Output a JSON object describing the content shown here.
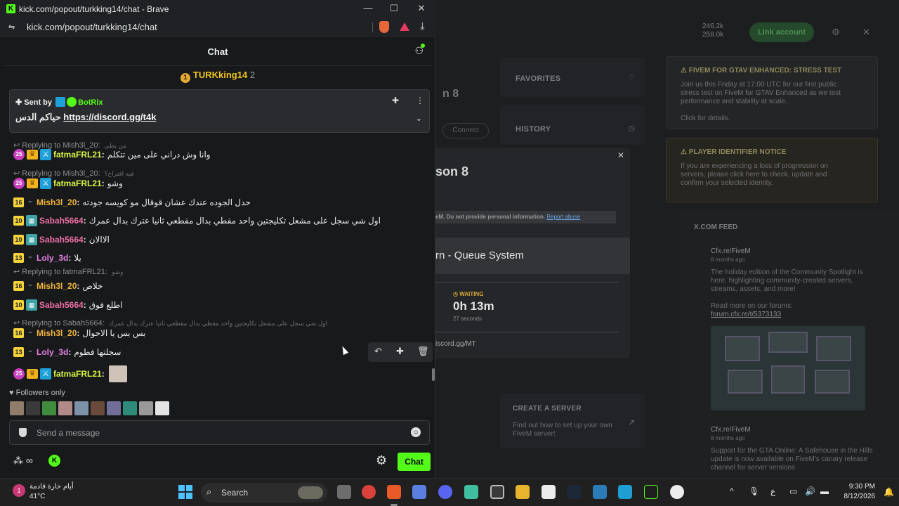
{
  "window": {
    "title": "kick.com/popout/turkking14/chat - Brave",
    "url": "kick.com/popout/turkking14/chat"
  },
  "chat": {
    "header_title": "Chat",
    "gift": {
      "user": "TURKking14",
      "count": "2"
    },
    "pinned": {
      "sent_by_label": "Sent by",
      "bot_name": "BotRix",
      "text": "حياكم الدس",
      "link": "https://discord.gg/t4k"
    },
    "messages": [
      {
        "reply_to": "Replying to Mish3l_20:",
        "reply_quote": "من بطي",
        "badges": [
          "circ:25",
          "crown",
          "sword"
        ],
        "user": "fatmaFRL21",
        "user_color": "#d7f742",
        "text": "وانا وش دراني على مين تتكلم"
      },
      {
        "reply_to": "Replying to Mish3l_20:",
        "reply_quote": "فيه اقتراح؟",
        "badges": [
          "circ:25",
          "crown",
          "sword"
        ],
        "user": "fatmaFRL21",
        "user_color": "#d7f742",
        "text": "وشو"
      },
      {
        "badges": [
          "num:16",
          "dash"
        ],
        "user": "Mish3l_20",
        "user_color": "#f0b43c",
        "text": "حدل الجوده عندك عشان قوقال مو كويسه جودته"
      },
      {
        "badges": [
          "num:10",
          "grid"
        ],
        "user": "Sabah5664",
        "user_color": "#ee6fa6",
        "text": "اول شي سجل على مشعل تكليجتين واحد مقطي بدال مقطعي ثانيا عترك بدال عمرك"
      },
      {
        "badges": [
          "num:10",
          "grid"
        ],
        "user": "Sabah5664",
        "user_color": "#ee6fa6",
        "text": "الاالان"
      },
      {
        "badges": [
          "num:13",
          "dash"
        ],
        "user": "Loly_3d",
        "user_color": "#e580e6",
        "text": "يلا"
      },
      {
        "reply_to": "Replying to fatmaFRL21:",
        "reply_quote": "وشو",
        "badges": [
          "num:16",
          "dash"
        ],
        "user": "Mish3l_20",
        "user_color": "#f0b43c",
        "text": "خلاص"
      },
      {
        "badges": [
          "num:10",
          "grid"
        ],
        "user": "Sabah5664",
        "user_color": "#ee6fa6",
        "text": "اطلع فوق"
      },
      {
        "reply_to": "Replying to Sabah5664:",
        "reply_quote": "اول شي سجل على مشعل تكليجتين واحد مقطي بدال مقطعي ثانيا عترك بدال عمرك",
        "badges": [
          "num:16",
          "dash"
        ],
        "user": "Mish3l_20",
        "user_color": "#f0b43c",
        "text": "بس بس يا الاحوال"
      },
      {
        "badges": [
          "num:13",
          "dash"
        ],
        "user": "Loly_3d",
        "user_color": "#e580e6",
        "text": "سجلتها فطوم"
      },
      {
        "badges": [
          "circ:25",
          "crown",
          "sword"
        ],
        "user": "fatmaFRL21",
        "user_color": "#d7f742",
        "text": ""
      }
    ],
    "followers_only": "Followers only",
    "input_placeholder": "Send a message",
    "send_button": "Chat"
  },
  "background_app": {
    "stats": [
      "246.2k",
      "258.0k"
    ],
    "link_account": "Link account",
    "favorites": "FAVORITES",
    "history": "HISTORY",
    "connect": "Connect",
    "season_digit": "n 8",
    "notice1_title": "FIVEM FOR GTAV ENHANCED: STRESS TEST",
    "notice1_body": "Join us this Friday at 17:00 UTC for our first public stress test on FiveM for GTAV Enhanced as we test performance and stability at scale.",
    "notice1_link": "Click for details.",
    "notice2_title": "PLAYER IDENTIFIER NOTICE",
    "notice2_body": "If you are experiencing a loss of progression on servers, please click here to check, update and confirm your selected identity.",
    "feed_title": "X.COM FEED",
    "feed_items": [
      {
        "user": "Cfx.re/FiveM",
        "age": "8 months ago",
        "text": "The holiday edition of the Community Spotlight is here, highlighting community-created servers, streams, assets, and more!",
        "link_label": "Read more on our forums:",
        "link": "forum.cfx.re/t/5373133"
      },
      {
        "user": "Cfx.re/FiveM",
        "age": "8 months ago",
        "text": "Support for the GTA Online: A Safehouse in the Hills update is now available on FiveM's canary release channel for server versions"
      }
    ],
    "create_title": "CREATE A SERVER",
    "create_body": "Find out how to set up your own FiveM server!",
    "modal": {
      "season": "son 8",
      "abuse_text": "eM. Do not provide personal information.",
      "abuse_link": "Report abuse",
      "queue": "rn - Queue System",
      "waiting_label": "WAITING",
      "time": "0h 13m",
      "seconds": "27 seconds",
      "discord": "iscord.gg/MT"
    }
  },
  "taskbar": {
    "weather_text": "أيام حارة قادمة",
    "temperature": "41°C",
    "search_label": "Search",
    "time": "9:30 PM",
    "date": "8/12/2026",
    "lang": "ع"
  },
  "colors": {
    "kick_green": "#53fc18",
    "gift_gold": "#f0c419",
    "bg_dark": "#18191b"
  }
}
